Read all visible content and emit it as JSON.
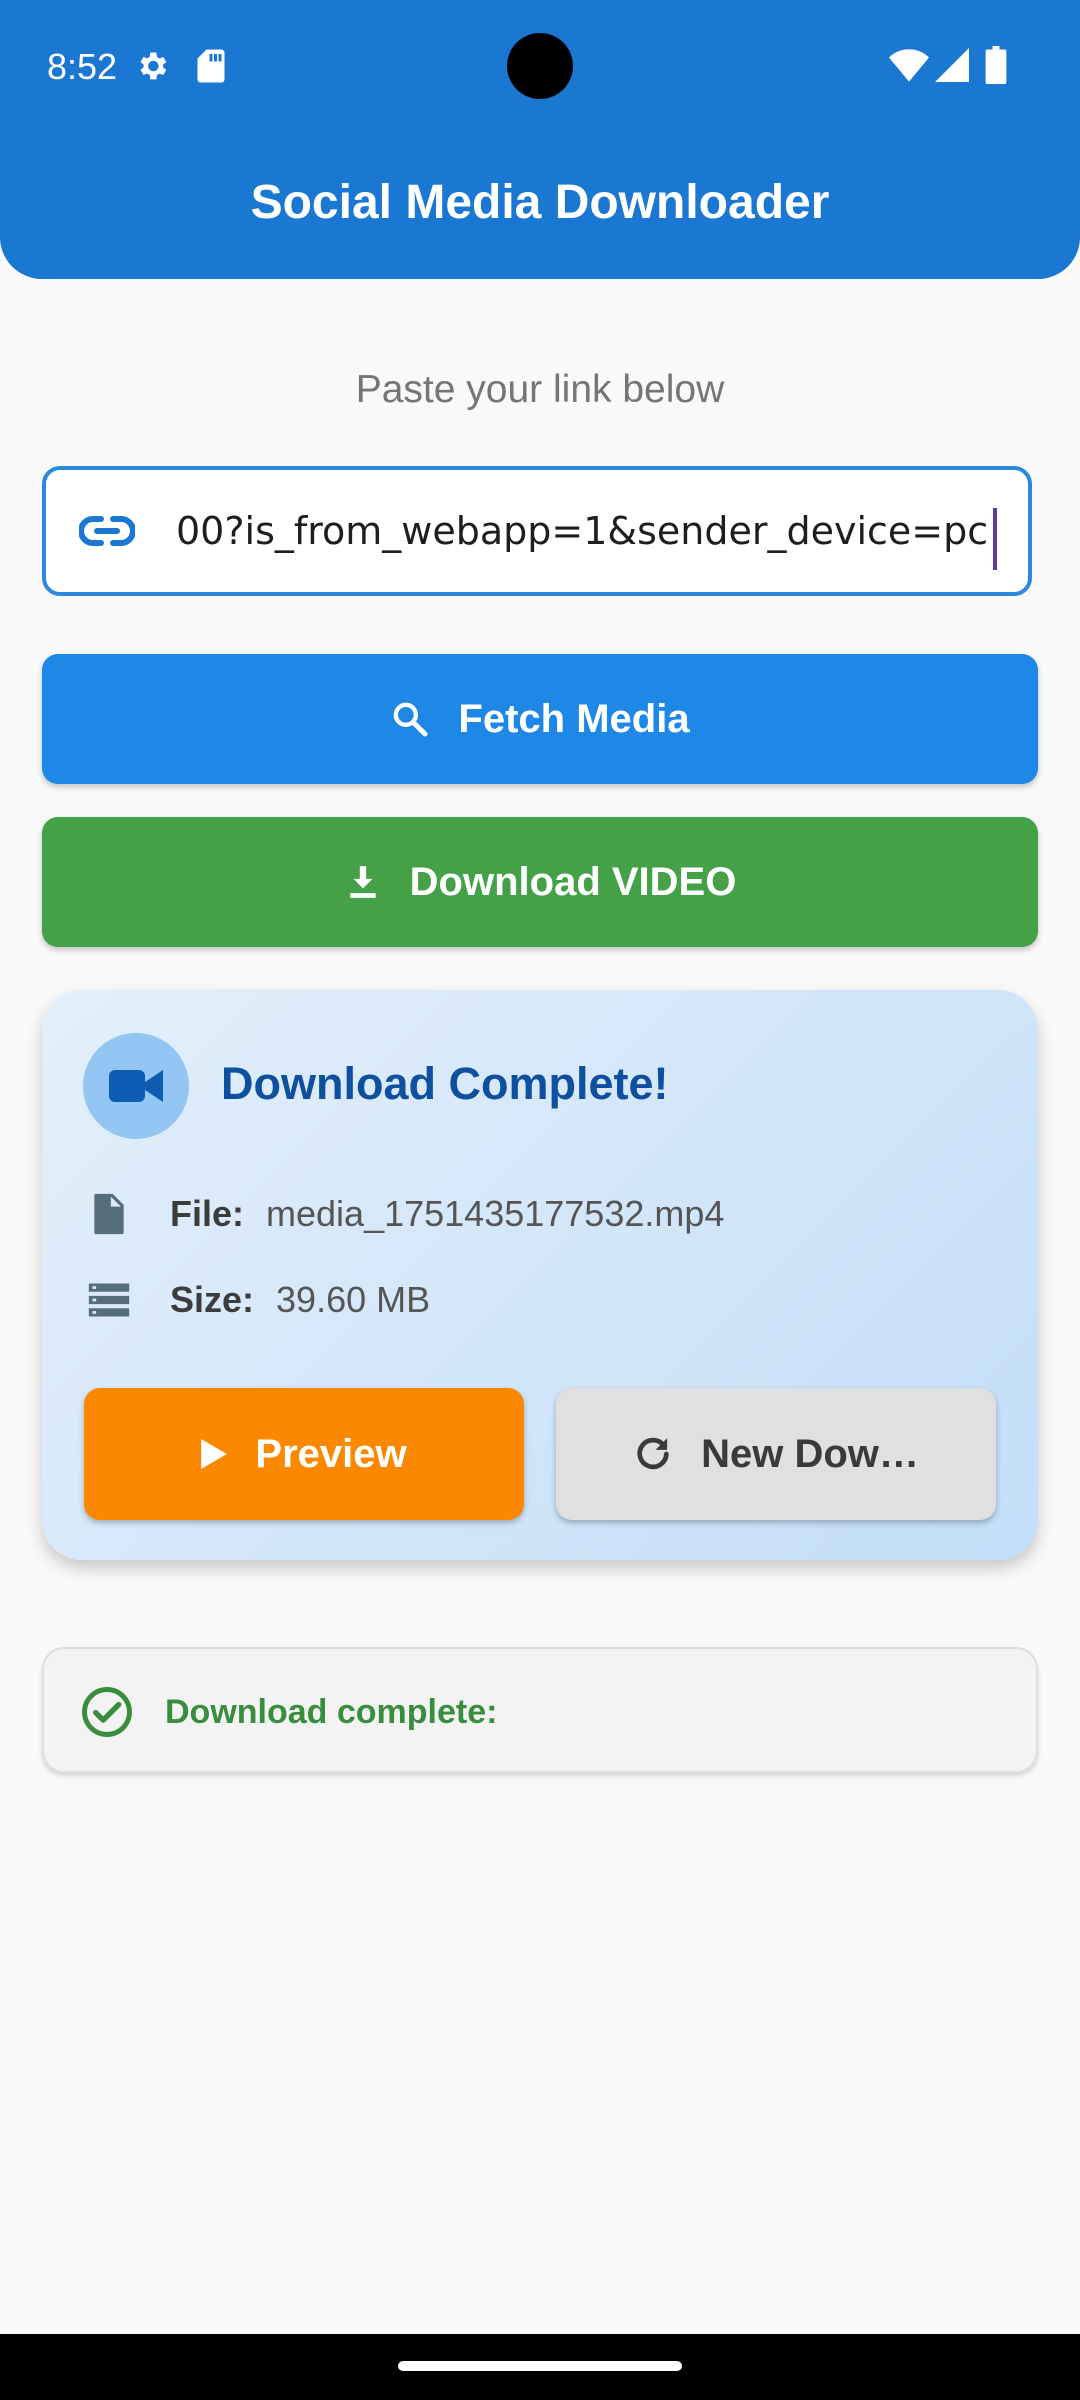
{
  "status_bar": {
    "time": "8:52",
    "icons": [
      "gear-icon",
      "sd-card-icon",
      "wifi-icon",
      "signal-icon",
      "battery-icon"
    ]
  },
  "app_bar": {
    "title": "Social Media Downloader"
  },
  "main": {
    "hint": "Paste your link below",
    "url_input": {
      "value": "00?is_from_webapp=1&sender_device=pc",
      "icon": "link-icon"
    },
    "fetch_button": {
      "label": "Fetch Media",
      "icon": "search-icon"
    },
    "download_button": {
      "label": "Download VIDEO",
      "icon": "download-icon"
    }
  },
  "result_card": {
    "title": "Download Complete!",
    "icon": "videocam-icon",
    "file_label": "File:",
    "file_value": "media_1751435177532.mp4",
    "size_label": "Size:",
    "size_value": "39.60 MB",
    "preview_button": "Preview",
    "new_download_button": "New Dow…"
  },
  "status": {
    "text": "Download complete:",
    "icon": "check-circle-icon"
  },
  "colors": {
    "primary": "#1a77d2",
    "fetch": "#1f88e6",
    "download": "#45a147",
    "preview": "#fc8800",
    "success": "#388e3c"
  }
}
